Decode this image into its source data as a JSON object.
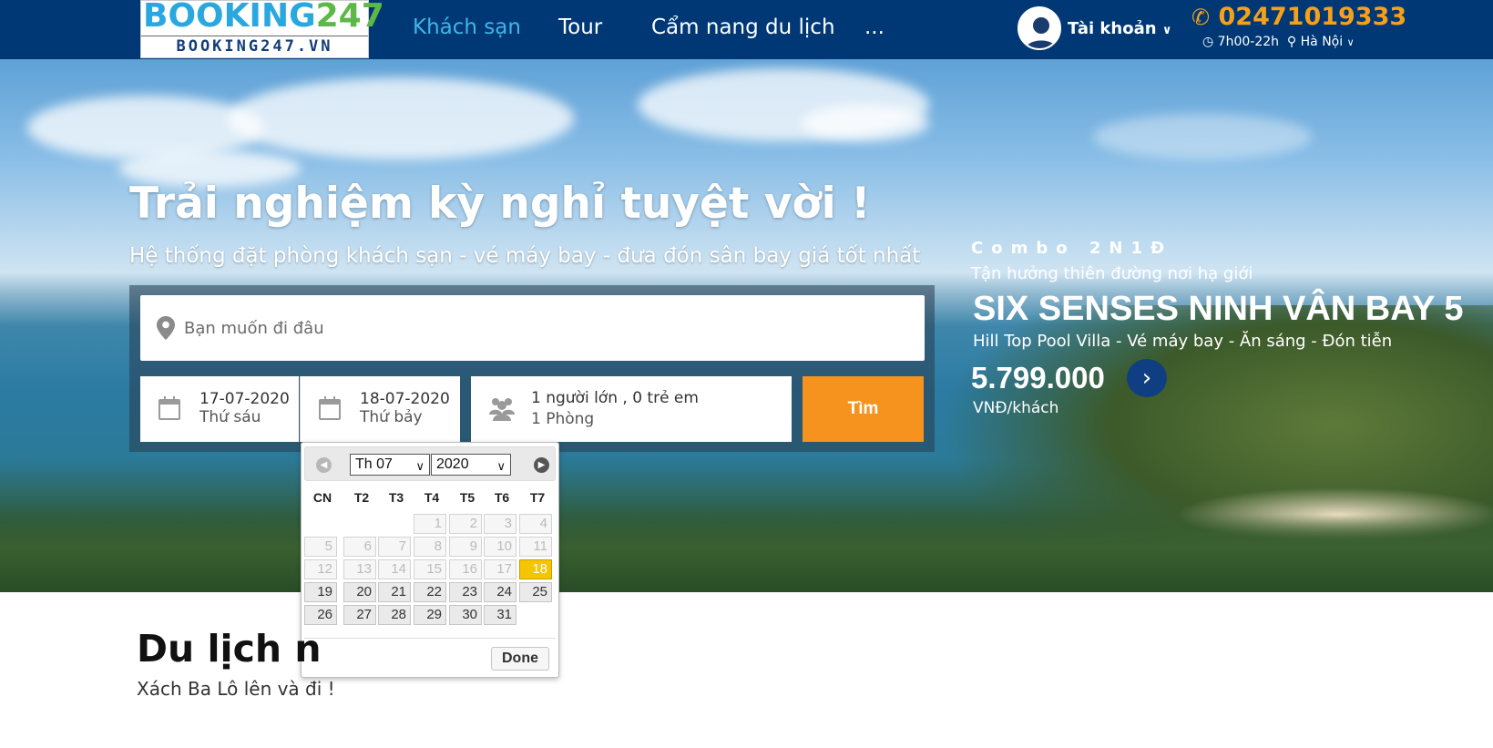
{
  "header": {
    "logo_top_a": "BOOKING",
    "logo_top_b": "247",
    "logo_bottom": "BOOKING247.VN",
    "nav": [
      "Khách sạn",
      "Tour",
      "Cẩm nang du lịch",
      "..."
    ],
    "account": "Tài khoản",
    "phone": "02471019333",
    "hours": "7h00-22h",
    "city": "Hà Nội",
    "colors": {
      "bg": "#003876",
      "active": "#3fb6e8",
      "phone": "#f6a01a"
    }
  },
  "hero": {
    "title": "Trải nghiệm kỳ nghỉ tuyệt vời !",
    "subtitle": "Hệ thống đặt phòng khách sạn - vé máy bay - đưa đón sân bay giá tốt nhất"
  },
  "promo": {
    "kicker": "Combo 2N1Đ",
    "line": "Tận hưởng thiên đường nơi hạ giới",
    "title": "SIX SENSES NINH VÂN BAY 5",
    "desc": "Hill Top Pool Villa - Vé máy bay - Ăn sáng - Đón tiễn",
    "price": "5.799.000",
    "unit": "VNĐ/khách"
  },
  "search": {
    "placeholder": "Bạn muốn đi đâu",
    "checkin_date": "17-07-2020",
    "checkin_day": "Thứ sáu",
    "checkout_date": "18-07-2020",
    "checkout_day": "Thứ bảy",
    "guests": "1 người lớn , 0 trẻ em",
    "rooms": "1 Phòng",
    "button": "Tìm",
    "button_color": "#f6931f"
  },
  "datepicker": {
    "month": "Th 07",
    "year": "2020",
    "dow": [
      "CN",
      "T2",
      "T3",
      "T4",
      "T5",
      "T6",
      "T7"
    ],
    "weeks": [
      [
        "",
        "",
        "",
        "1",
        "2",
        "3",
        "4"
      ],
      [
        "5",
        "6",
        "7",
        "8",
        "9",
        "10",
        "11"
      ],
      [
        "12",
        "13",
        "14",
        "15",
        "16",
        "17",
        "18"
      ],
      [
        "19",
        "20",
        "21",
        "22",
        "23",
        "24",
        "25"
      ],
      [
        "26",
        "27",
        "28",
        "29",
        "30",
        "31",
        ""
      ]
    ],
    "selected": "18",
    "first_enabled": 18,
    "done": "Done"
  },
  "section": {
    "title": "Du lịch n",
    "subtitle": "Xách Ba Lô lên và đi !"
  }
}
